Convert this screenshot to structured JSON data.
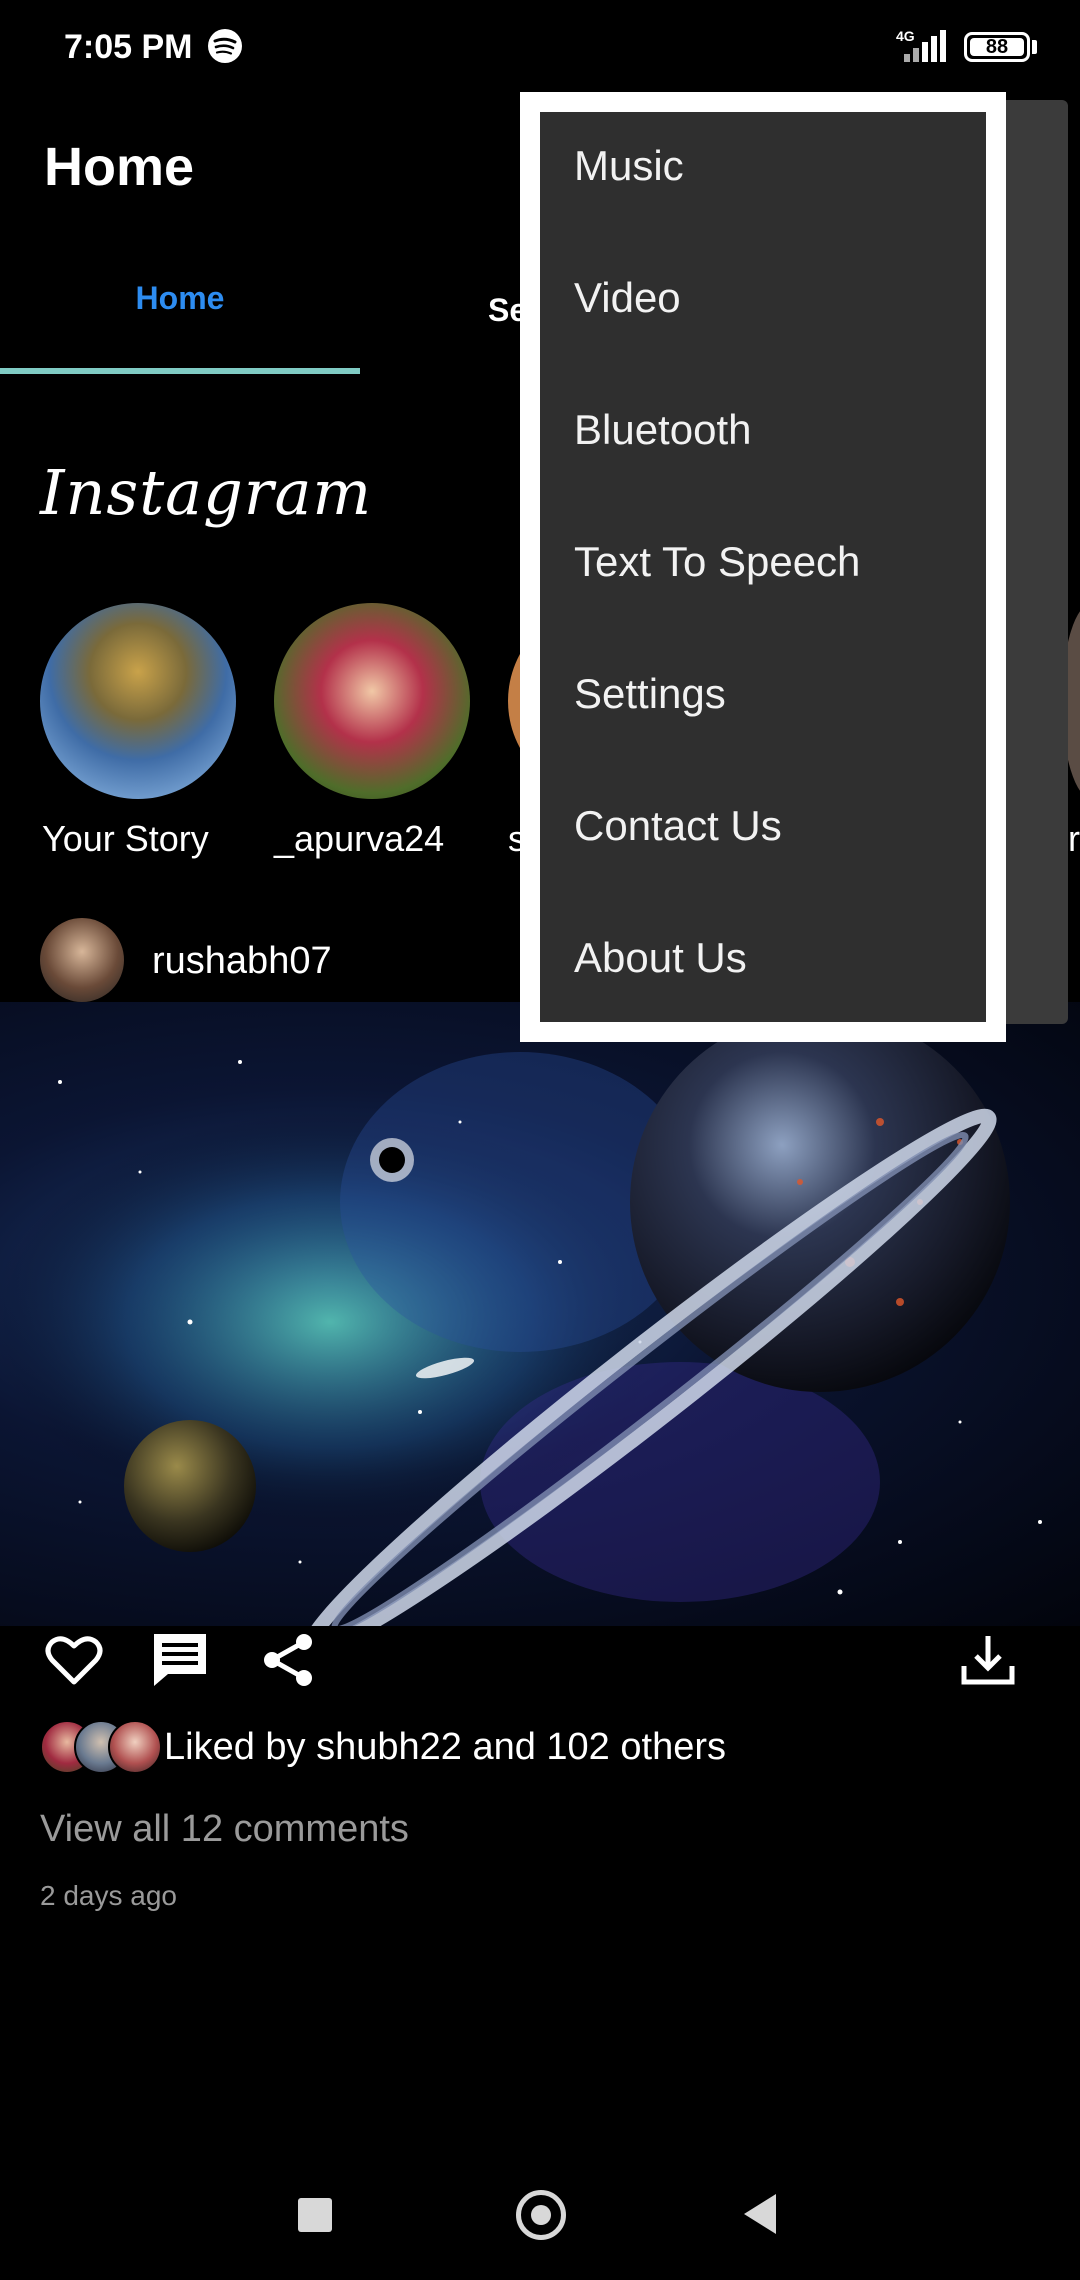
{
  "status_bar": {
    "time": "7:05 PM",
    "network": "4G",
    "battery": "88",
    "icons": [
      "spotify-icon",
      "signal-icon",
      "battery-icon"
    ]
  },
  "app_bar": {
    "title": "Home"
  },
  "tabs": [
    {
      "label": "Home",
      "active": true
    },
    {
      "label": "Se",
      "active": false
    }
  ],
  "feed": {
    "logo": "Instagram",
    "stories": [
      {
        "label": "Your Story"
      },
      {
        "label": "_apurva24"
      },
      {
        "label": "s"
      },
      {
        "label": "r"
      }
    ],
    "post": {
      "username": "rushabh07",
      "likes_text": "Liked by shubh22 and 102 others",
      "comments_link": "View all 12 comments",
      "time_ago": "2 days ago"
    }
  },
  "menu": {
    "items": [
      "Music",
      "Video",
      "Bluetooth",
      "Text To Speech",
      "Settings",
      "Contact Us",
      "About Us"
    ]
  },
  "colors": {
    "accent_tab": "#2d8cf0",
    "tab_indicator": "#80cbc4",
    "menu_bg": "#2f2f2f",
    "menu_border": "#ffffff",
    "muted_text": "#9a9a9a"
  }
}
